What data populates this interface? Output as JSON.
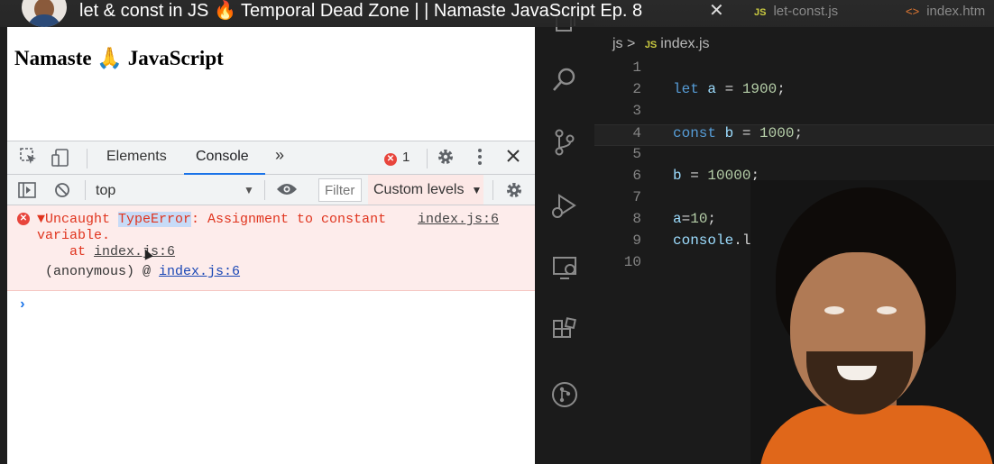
{
  "video": {
    "title": "let & const in JS 🔥 Temporal Dead Zone | | Namaste JavaScript Ep. 8",
    "close_glyph": "✕",
    "bg_tabs": [
      {
        "icon": "JS",
        "label": "let-const.js"
      },
      {
        "icon": "<>",
        "label": "index.htm"
      }
    ]
  },
  "browser": {
    "page_heading": "Namaste 🙏 JavaScript",
    "devtools": {
      "tabs": [
        "Elements",
        "Console"
      ],
      "active_tab": "Console",
      "more_glyph": "»",
      "error_count": "1",
      "context": "top",
      "filter_placeholder": "Filter",
      "levels": "Custom levels",
      "colors": {
        "error_bg": "#fdeceb",
        "error_text": "#e0341e",
        "accent": "#1a73e8"
      }
    },
    "console": {
      "error": {
        "prefix": "▼Uncaught ",
        "type": "TypeError",
        "message": ": Assignment to constant",
        "message_cont": "variable.",
        "at_prefix": "at ",
        "at_link": "index.js:6",
        "source": "index.js:6",
        "anon_prefix": "(anonymous) @ ",
        "anon_link": "index.js:6"
      },
      "prompt": "›"
    }
  },
  "editor": {
    "breadcrumb": {
      "folder": "js",
      "sep": ">",
      "icon": "JS",
      "file": "index.js"
    },
    "current_line": 4,
    "lines": [
      {
        "n": "1",
        "tokens": []
      },
      {
        "n": "2",
        "tokens": [
          {
            "t": "let",
            "c": "kw"
          },
          {
            "t": " a",
            "c": "var"
          },
          {
            "t": " = ",
            "c": ""
          },
          {
            "t": "1900",
            "c": "num"
          },
          {
            "t": ";",
            "c": ""
          }
        ]
      },
      {
        "n": "3",
        "tokens": []
      },
      {
        "n": "4",
        "tokens": [
          {
            "t": "const",
            "c": "kw"
          },
          {
            "t": " b",
            "c": "var"
          },
          {
            "t": " = ",
            "c": ""
          },
          {
            "t": "1000",
            "c": "num"
          },
          {
            "t": ";",
            "c": ""
          }
        ]
      },
      {
        "n": "5",
        "tokens": []
      },
      {
        "n": "6",
        "tokens": [
          {
            "t": "b",
            "c": "var"
          },
          {
            "t": " = ",
            "c": ""
          },
          {
            "t": "10000",
            "c": "num"
          },
          {
            "t": ";",
            "c": ""
          }
        ]
      },
      {
        "n": "7",
        "tokens": []
      },
      {
        "n": "8",
        "tokens": [
          {
            "t": "a",
            "c": "var"
          },
          {
            "t": "=",
            "c": ""
          },
          {
            "t": "10",
            "c": "num"
          },
          {
            "t": ";",
            "c": ""
          }
        ]
      },
      {
        "n": "9",
        "tokens": [
          {
            "t": "console",
            "c": "var"
          },
          {
            "t": ".log(",
            "c": ""
          }
        ]
      },
      {
        "n": "10",
        "tokens": []
      }
    ]
  }
}
